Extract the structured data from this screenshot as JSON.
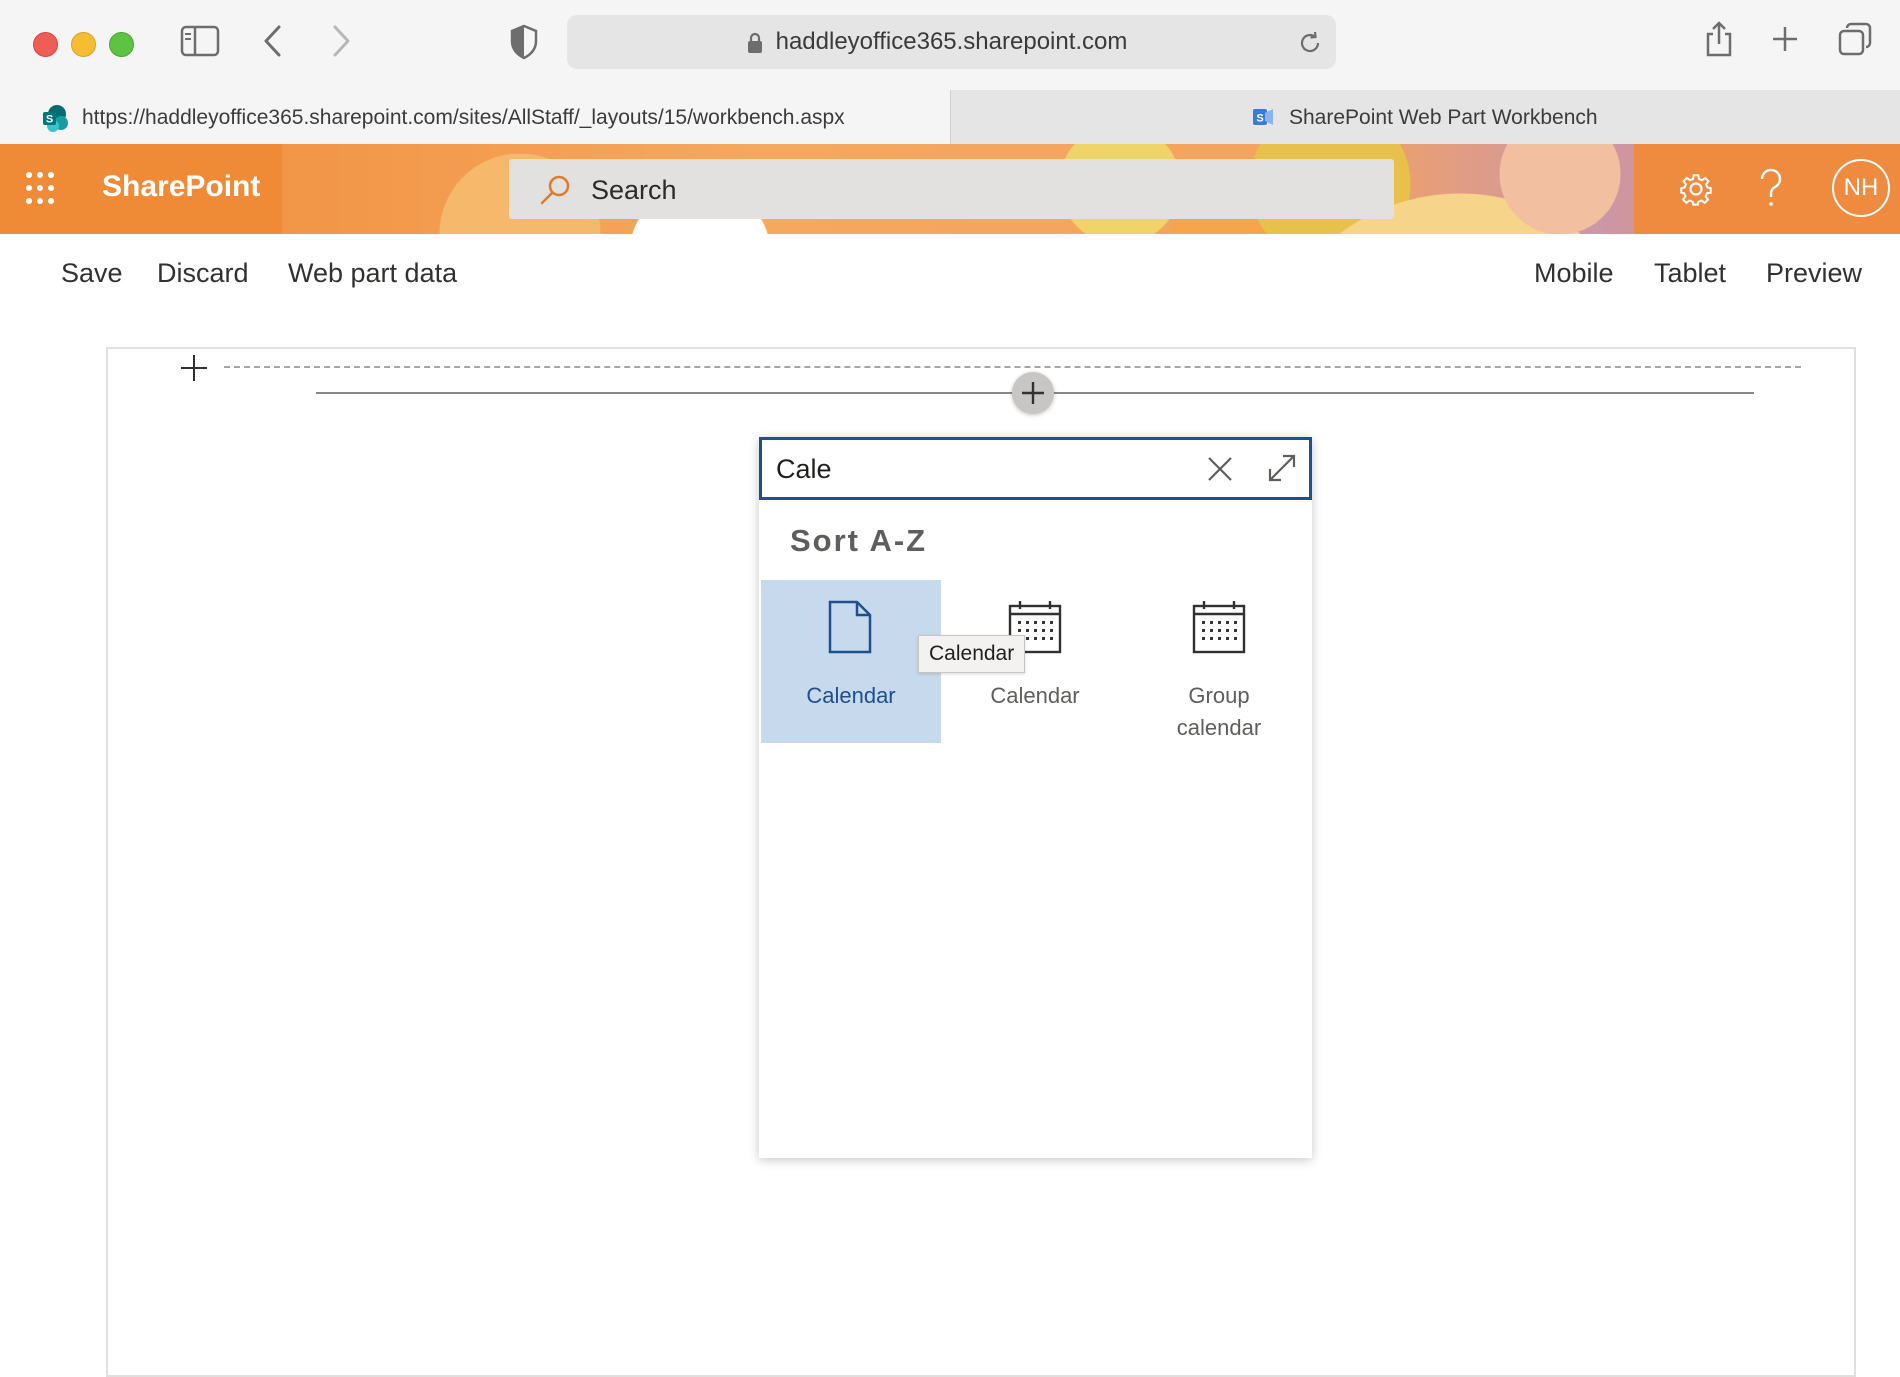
{
  "browser": {
    "address": "haddleyoffice365.sharepoint.com",
    "tabs": [
      {
        "label": "https://haddleyoffice365.sharepoint.com/sites/AllStaff/_layouts/15/workbench.aspx",
        "icon": "sharepoint-favicon-icon",
        "active": true
      },
      {
        "label": "SharePoint Web Part Workbench",
        "icon": "sharepoint-framework-icon",
        "active": false
      }
    ]
  },
  "suitebar": {
    "app_name": "SharePoint",
    "search_placeholder": "Search",
    "avatar_initials": "NH"
  },
  "commandbar": {
    "left": [
      "Save",
      "Discard",
      "Web part data"
    ],
    "right": [
      "Mobile",
      "Tablet",
      "Preview"
    ]
  },
  "toolbox": {
    "search_value": "Cale",
    "sort_label": "Sort A-Z",
    "items": [
      {
        "label": "Calendar",
        "icon": "document-icon",
        "selected": true
      },
      {
        "label": "Calendar",
        "icon": "calendar-icon",
        "selected": false
      },
      {
        "label": "Group calendar",
        "icon": "calendar-icon",
        "selected": false
      }
    ],
    "tooltip": "Calendar"
  },
  "colors": {
    "accent": "#1f4f8c",
    "selected_item_bg": "#c7d9ec",
    "suitebar_orange": "#ef8a36"
  }
}
